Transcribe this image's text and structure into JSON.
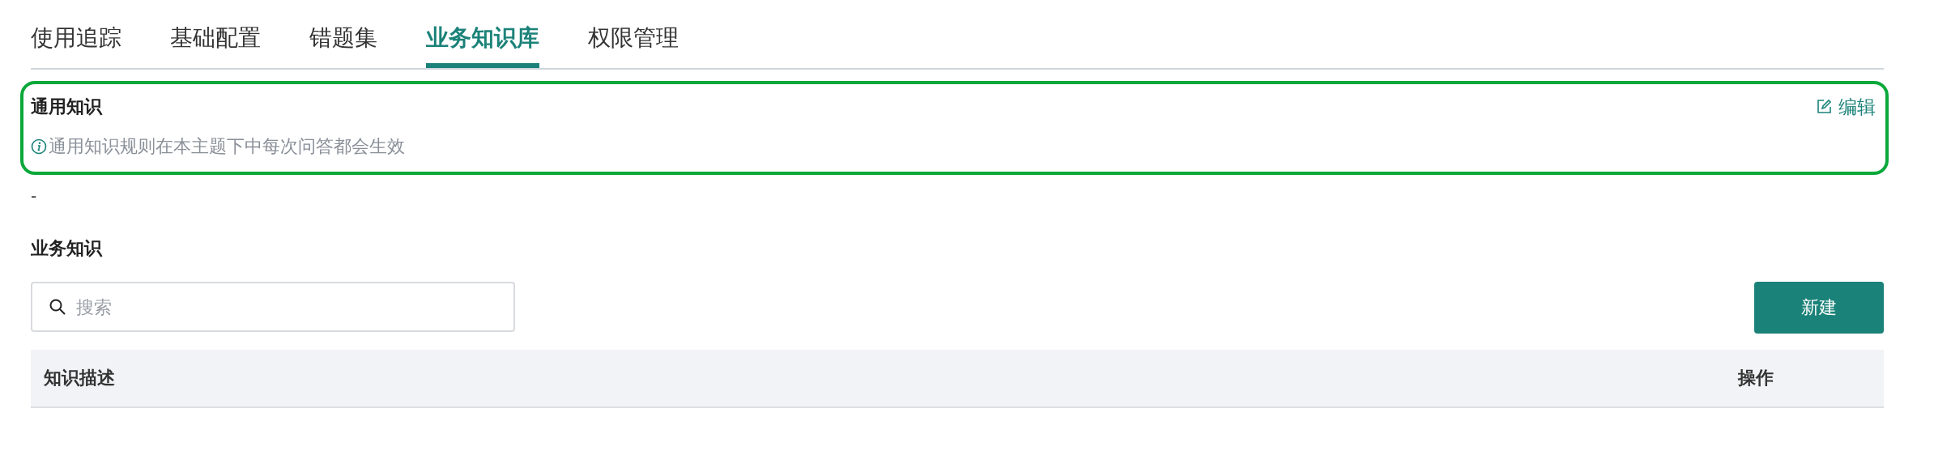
{
  "tabs": [
    {
      "label": "使用追踪",
      "selected": false
    },
    {
      "label": "基础配置",
      "selected": false
    },
    {
      "label": "错题集",
      "selected": false
    },
    {
      "label": "业务知识库",
      "selected": true
    },
    {
      "label": "权限管理",
      "selected": false
    }
  ],
  "general_knowledge": {
    "title": "通用知识",
    "edit_label": "编辑",
    "hint": "通用知识规则在本主题下中每次问答都会生效",
    "value": "-"
  },
  "business_knowledge": {
    "title": "业务知识",
    "search": {
      "placeholder": "搜索"
    },
    "new_button": "新建",
    "table": {
      "columns": [
        "知识描述",
        "操作"
      ]
    }
  }
}
